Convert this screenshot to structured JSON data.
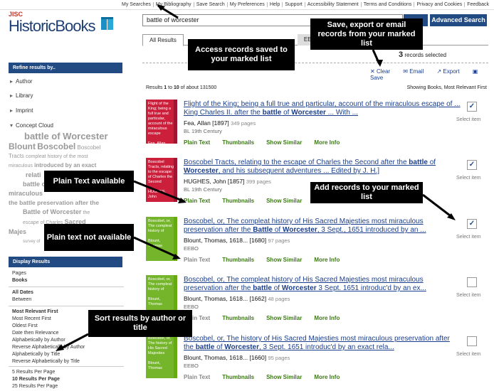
{
  "topnav": [
    "My Searches",
    "My Bibliography",
    "Save Search",
    "My Preferences",
    "Help",
    "Support",
    "Accessibility Statement",
    "Terms and Conditions",
    "Privacy and Cookies",
    "Feedback"
  ],
  "logo": {
    "jisc": "JISC",
    "name": "HistoricBooks"
  },
  "search": {
    "value": "battle of worcester",
    "advanced_label": "Advanced Search"
  },
  "tabs": {
    "all": "All Results",
    "eebo": "EEBO"
  },
  "records_selected": {
    "count": "3",
    "label": "records selected"
  },
  "actions": [
    "Clear",
    "Email",
    "Export",
    "Save"
  ],
  "results_info": {
    "prefix": "Results ",
    "range_start": "1",
    "to": " to ",
    "range_end": "10",
    "of": " of about 131500"
  },
  "sort_info": "Showing Books, Most Relevant First",
  "sidebar": {
    "refine_title": "Refine results by..",
    "facets": [
      "Author",
      "Library",
      "Imprint",
      "Concept Cloud"
    ],
    "display_title": "Display Results",
    "display_types": [
      "Pages",
      "Books"
    ],
    "date_opts": [
      "All Dates",
      "Between"
    ],
    "sort_opts": [
      "Most Relevant First",
      "Most Recent First",
      "Oldest First",
      "Date then Relevance",
      "Alphabetically by Author",
      "Reverse Alphabetically by Author",
      "Alphabetically by Title",
      "Reverse Alphabetically by Title"
    ],
    "per_page": [
      "5 Results Per Page",
      "10 Results Per Page",
      "25 Results Per Page"
    ]
  },
  "cloud": [
    "battle of Worcester",
    "Blount",
    "Boscobel",
    "Boscobel",
    "Tracts",
    "compleat history of the most",
    "miraculous",
    "introduced by an exact",
    "relati",
    "battle of",
    "miraculous",
    "the battle preservation after the",
    "Battle of Worcester",
    "the",
    "escape of Charles",
    "Sacred",
    "Majes",
    "survey of"
  ],
  "results": [
    {
      "thumb": "Flight of the King; being a full true and particular, account of the miraculous escape",
      "thumb_author": "Fea, Allan",
      "color": "red",
      "title_pre": "Flight of the King; being a full true and particular, account of the miraculous escape of ... King Charles II. after the ",
      "title_b1": "battle",
      "title_mid": " of ",
      "title_b2": "Worcester",
      "title_post": " ... With ...",
      "author": "Fea, Allan [1897]",
      "pages": "349 pages",
      "source": "BL 19th Century",
      "checked": "✓"
    },
    {
      "thumb": "Boscobel Tracts, relating to the escape of Charles the Second",
      "thumb_author": "HUGHES, John",
      "color": "red",
      "title_pre": "Boscobel Tracts, relating to the escape of Charles the Second after the ",
      "title_b1": "battle",
      "title_mid": " of ",
      "title_b2": "Worcester",
      "title_post": ", and his subsequent adventures ... Edited by J. H.]",
      "author": "HUGHES, John [1857]",
      "pages": "399 pages",
      "source": "BL 19th Century",
      "checked": "✓"
    },
    {
      "thumb": "Boscobel, or, The compleat history of",
      "thumb_author": "Blount, Thomas",
      "color": "grn",
      "title_pre": "Boscobel, or, The compleat history of His Sacred Majesties most miraculous preservation after the ",
      "title_b1": "Battle",
      "title_mid": " of ",
      "title_b2": "Worcester",
      "title_post": ", 3 Sept., 1651 introduced by an ...",
      "author": "Blount, Thomas, 1618... [1680]",
      "pages": "97 pages",
      "source": "EEBO",
      "checked": "✓"
    },
    {
      "thumb": "Boscobel, or, The compleat history of",
      "thumb_author": "Blount, Thomas",
      "color": "grn",
      "title_pre": "Boscobel, or, The compleat history of His Sacred Majesties most miraculous preservation after the ",
      "title_b1": "battle",
      "title_mid": " of ",
      "title_b2": "Worcester",
      "title_post": " 3 Sept. 1651 introduc'd by an ex...",
      "author": "Blount, Thomas, 1618... [1662]",
      "pages": "48 pages",
      "source": "EEBO",
      "checked": ""
    },
    {
      "thumb": "Boscobel, or, The history of His Sacred Majesties",
      "thumb_author": "Blount, Thomas",
      "color": "grn",
      "title_pre": "Boscobel, or, The history of His Sacred Majesties most miraculous preservation after the ",
      "title_b1": "battle",
      "title_mid": " of ",
      "title_b2": "Worcester",
      "title_post": ", 3 Sept. 1651 introduc'd by an exact rela...",
      "author": "Blount, Thomas, 1618... [1660]",
      "pages": "95 pages",
      "source": "EEBO",
      "checked": ""
    }
  ],
  "result_links": {
    "plain": "Plain Text",
    "thumbs": "Thumbnails",
    "similar": "Show Similar",
    "more": "More Info",
    "select": "Select item"
  },
  "callouts": {
    "marked": "Access records saved to your marked list",
    "save": "Save, export or email records from your marked list",
    "plain": "Plain Text available",
    "add": "Add records to your marked list",
    "noplain": "Plain text not available",
    "sort": "Sort results by author or title"
  },
  "colors": {
    "navy": "#234b83",
    "link": "#1a3e8c",
    "green": "#3b7a12",
    "thumb_red": "#cc1f3c",
    "thumb_green": "#74b52b"
  }
}
